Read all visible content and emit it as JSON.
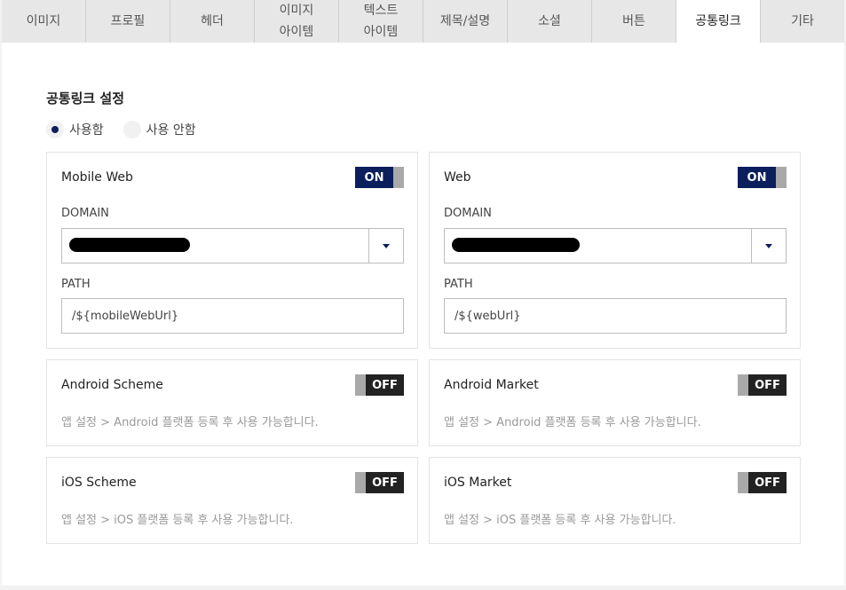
{
  "tabs": [
    {
      "label": "이미지"
    },
    {
      "label": "프로필"
    },
    {
      "label": "헤더"
    },
    {
      "line1": "이미지",
      "line2": "아이템"
    },
    {
      "line1": "텍스트",
      "line2": "아이템"
    },
    {
      "label": "제목/설명"
    },
    {
      "label": "소셜"
    },
    {
      "label": "버튼"
    },
    {
      "label": "공통링크",
      "active": true
    },
    {
      "label": "기타"
    }
  ],
  "section": {
    "title": "공통링크 설정",
    "radio": {
      "on_label": "사용함",
      "off_label": "사용 안함",
      "selected": "사용함"
    }
  },
  "cards": {
    "mobile_web": {
      "title": "Mobile Web",
      "toggle": "ON",
      "domain_label": "DOMAIN",
      "domain_value": "[redacted]",
      "path_label": "PATH",
      "path_value": "/${mobileWebUrl}"
    },
    "web": {
      "title": "Web",
      "toggle": "ON",
      "domain_label": "DOMAIN",
      "domain_value": "[redacted]",
      "path_label": "PATH",
      "path_value": "/${webUrl}"
    },
    "android_scheme": {
      "title": "Android Scheme",
      "toggle": "OFF",
      "hint": "앱 설정 > Android 플랫폼 등록 후 사용 가능합니다."
    },
    "android_market": {
      "title": "Android Market",
      "toggle": "OFF",
      "hint": "앱 설정 > Android 플랫폼 등록 후 사용 가능합니다."
    },
    "ios_scheme": {
      "title": "iOS Scheme",
      "toggle": "OFF",
      "hint": "앱 설정 > iOS 플랫폼 등록 후 사용 가능합니다."
    },
    "ios_market": {
      "title": "iOS Market",
      "toggle": "OFF",
      "hint": "앱 설정 > iOS 플랫폼 등록 후 사용 가능합니다."
    }
  },
  "colors": {
    "accent": "#0b1f5c",
    "toggle_off": "#222222",
    "knob": "#a9a9a9",
    "hint_text": "#9a9a9a"
  },
  "icons": {
    "dropdown": "caret-down-icon",
    "radio": "radio-dot-icon"
  }
}
